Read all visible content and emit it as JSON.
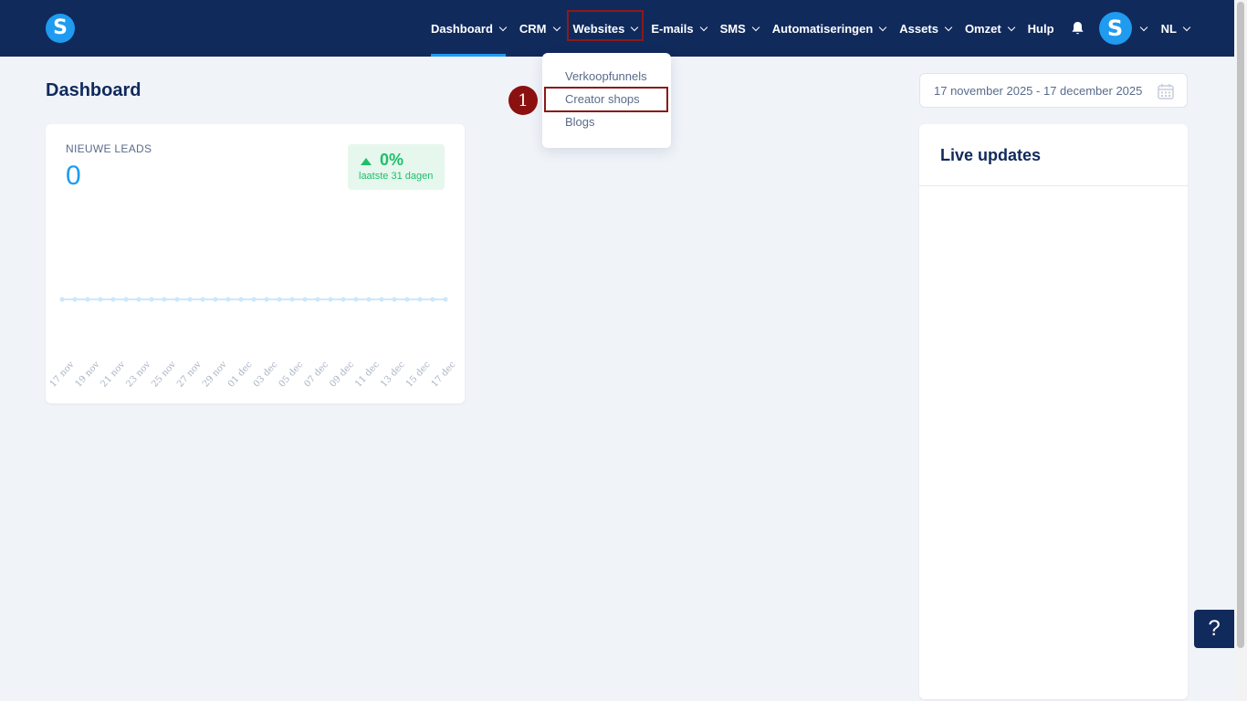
{
  "brand": {
    "logo_letter": "S",
    "primary": "#102a5c",
    "accent": "#1f9bf0",
    "positive": "#1fbf6a",
    "annotation": "#8b1a1a"
  },
  "nav": {
    "items": [
      {
        "label": "Dashboard",
        "has_chevron": true
      },
      {
        "label": "CRM",
        "has_chevron": true
      },
      {
        "label": "Websites",
        "has_chevron": true
      },
      {
        "label": "E-mails",
        "has_chevron": true
      },
      {
        "label": "SMS",
        "has_chevron": true
      },
      {
        "label": "Automatiseringen",
        "has_chevron": true
      },
      {
        "label": "Assets",
        "has_chevron": true
      },
      {
        "label": "Omzet",
        "has_chevron": true
      },
      {
        "label": "Hulp",
        "has_chevron": false
      }
    ],
    "avatar_letter": "S",
    "language": "NL",
    "icons": {
      "bell": "bell-icon",
      "calendar": "calendar-icon"
    }
  },
  "dropdown": {
    "items": [
      "Verkoopfunnels",
      "Creator shops",
      "Blogs"
    ]
  },
  "annotation": {
    "step": "1"
  },
  "page": {
    "title": "Dashboard",
    "date_range": "17 november 2025 - 17 december 2025"
  },
  "leads": {
    "label": "NIEUWE LEADS",
    "value": "0",
    "badge_pct": "0%",
    "badge_sub": "laatste 31 dagen"
  },
  "chart_data": {
    "type": "line",
    "x": [
      "17 nov",
      "19 nov",
      "21 nov",
      "23 nov",
      "25 nov",
      "27 nov",
      "29 nov",
      "01 dec",
      "03 dec",
      "05 dec",
      "07 dec",
      "09 dec",
      "11 dec",
      "13 dec",
      "15 dec",
      "17 dec"
    ],
    "point_count": 31,
    "values": [
      0,
      0,
      0,
      0,
      0,
      0,
      0,
      0,
      0,
      0,
      0,
      0,
      0,
      0,
      0,
      0,
      0,
      0,
      0,
      0,
      0,
      0,
      0,
      0,
      0,
      0,
      0,
      0,
      0,
      0,
      0
    ],
    "color": "#cde8fb",
    "grid": false
  },
  "live": {
    "title": "Live updates"
  },
  "help": {
    "label": "?"
  }
}
